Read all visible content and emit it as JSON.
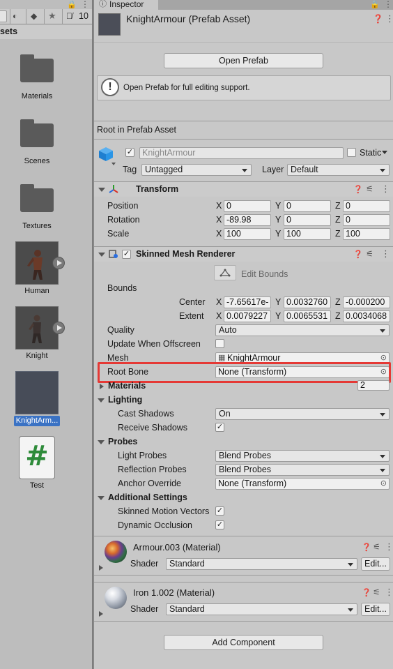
{
  "project": {
    "breadcrumb_fragment": "sets",
    "eye_count": "10",
    "assets": [
      {
        "label": "Materials",
        "kind": "folder-icon"
      },
      {
        "label": "Scenes",
        "kind": "folder-icon"
      },
      {
        "label": "Textures",
        "kind": "folder-icon"
      },
      {
        "label": "Human",
        "kind": "model-thumbnail"
      },
      {
        "label": "Knight",
        "kind": "model-thumbnail"
      },
      {
        "label": "KnightArm...",
        "kind": "prefab-thumbnail",
        "selected": true
      },
      {
        "label": "Test",
        "kind": "csharp-script-icon",
        "glyph": "#"
      }
    ]
  },
  "inspector": {
    "tab_label": "Inspector",
    "asset_title": "KnightArmour (Prefab Asset)",
    "open_prefab_button": "Open Prefab",
    "info_message": "Open Prefab for full editing support.",
    "root_label": "Root in Prefab Asset",
    "object_name": "KnightArmour",
    "static_label": "Static",
    "tag_label": "Tag",
    "tag_value": "Untagged",
    "layer_label": "Layer",
    "layer_value": "Default",
    "transform": {
      "title": "Transform",
      "position_label": "Position",
      "rotation_label": "Rotation",
      "scale_label": "Scale",
      "position": {
        "x": "0",
        "y": "0",
        "z": "0"
      },
      "rotation": {
        "x": "-89.98",
        "y": "0",
        "z": "0"
      },
      "scale": {
        "x": "100",
        "y": "100",
        "z": "100"
      }
    },
    "smr": {
      "title": "Skinned Mesh Renderer",
      "edit_bounds": "Edit Bounds",
      "bounds_label": "Bounds",
      "center_label": "Center",
      "extent_label": "Extent",
      "center": {
        "x": "-7.65617e-",
        "y": "0.0032760",
        "z": "-0.000200"
      },
      "extent": {
        "x": "0.0079227",
        "y": "0.0065531",
        "z": "0.0034068"
      },
      "quality_label": "Quality",
      "quality_value": "Auto",
      "update_offscreen_label": "Update When Offscreen",
      "mesh_label": "Mesh",
      "mesh_value": "KnightArmour",
      "root_bone_label": "Root Bone",
      "root_bone_value": "None (Transform)",
      "materials_label": "Materials",
      "materials_count": "2",
      "lighting_label": "Lighting",
      "cast_shadows_label": "Cast Shadows",
      "cast_shadows_value": "On",
      "receive_shadows_label": "Receive Shadows",
      "probes_label": "Probes",
      "light_probes_label": "Light Probes",
      "light_probes_value": "Blend Probes",
      "reflection_probes_label": "Reflection Probes",
      "reflection_probes_value": "Blend Probes",
      "anchor_override_label": "Anchor Override",
      "anchor_override_value": "None (Transform)",
      "additional_label": "Additional Settings",
      "motion_vectors_label": "Skinned Motion Vectors",
      "dynamic_occlusion_label": "Dynamic Occlusion"
    },
    "materials": [
      {
        "title": "Armour.003 (Material)",
        "shader_label": "Shader",
        "shader_value": "Standard",
        "edit_label": "Edit..."
      },
      {
        "title": "Iron 1.002 (Material)",
        "shader_label": "Shader",
        "shader_value": "Standard",
        "edit_label": "Edit..."
      }
    ],
    "add_component": "Add Component"
  },
  "colors": {
    "highlight": "#e53935",
    "selection": "#3a72c4",
    "script_green": "#2e8b3a"
  }
}
